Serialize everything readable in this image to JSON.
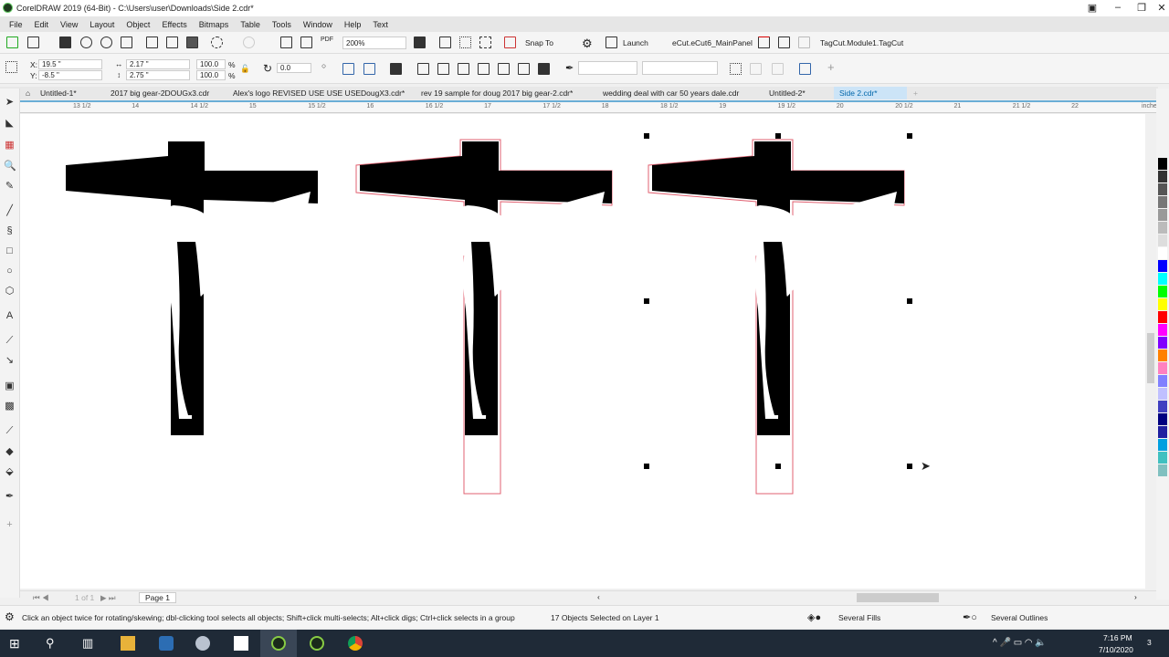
{
  "window": {
    "title": "CorelDRAW 2019 (64-Bit) - C:\\Users\\user\\Downloads\\Side 2.cdr*"
  },
  "menu": [
    "File",
    "Edit",
    "View",
    "Layout",
    "Object",
    "Effects",
    "Bitmaps",
    "Table",
    "Tools",
    "Window",
    "Help",
    "Text"
  ],
  "toolbar": {
    "zoom": "200%",
    "snap_to": "Snap To",
    "launch": "Launch",
    "macro1": "eCut.eCut6_MainPanel",
    "macro2": "TagCut.Module1.TagCut"
  },
  "property_bar": {
    "x": "19.5 \"",
    "y": "-8.5 \"",
    "width": "2.17 \"",
    "height": "2.75 \"",
    "scale_x": "100.0",
    "scale_y": "100.0",
    "pct": "%",
    "rotation": "0.0"
  },
  "tabs": [
    {
      "label": "Untitled-1*"
    },
    {
      "label": "2017 big gear-2DOUGx3.cdr"
    },
    {
      "label": "Alex's logo REVISED USE USE USEDougX3.cdr*"
    },
    {
      "label": "rev 19 sample for doug 2017 big gear-2.cdr*"
    },
    {
      "label": "wedding deal with car 50 years dale.cdr"
    },
    {
      "label": "Untitled-2*"
    },
    {
      "label": "Side 2.cdr*",
      "active": true
    }
  ],
  "ruler": {
    "labels": [
      "13 1/2",
      "14",
      "14 1/2",
      "15",
      "15 1/2",
      "16",
      "16 1/2",
      "17",
      "17 1/2",
      "18",
      "18 1/2",
      "19",
      "19 1/2",
      "20",
      "20 1/2",
      "21",
      "21 1/2",
      "22"
    ],
    "unit": "inches"
  },
  "page_nav": {
    "counter": "1 of 1",
    "page_tab": "Page 1"
  },
  "status": {
    "hint": "Click an object twice for rotating/skewing; dbl-clicking tool selects all objects; Shift+click multi-selects; Alt+click digs; Ctrl+click selects in a group",
    "selection": "17 Objects Selected on Layer 1",
    "fill": "Several Fills",
    "outline": "Several Outlines"
  },
  "taskbar": {
    "time": "7:16 PM",
    "date": "7/10/2020",
    "notifications": "3"
  },
  "colors": {
    "accent": "#0066aa",
    "outline_red": "#e06070",
    "palette": [
      "#000000",
      "#333333",
      "#555555",
      "#777777",
      "#999999",
      "#bbbbbb",
      "#dddddd",
      "#ffffff",
      "#0000ff",
      "#00ffff",
      "#00ff00",
      "#ffff00",
      "#ff0000",
      "#ff00ff",
      "#8000ff",
      "#ff8000",
      "#ff80c0",
      "#8080ff",
      "#c0c0ff",
      "#4040c0",
      "#000080",
      "#2020a0",
      "#00a0e0",
      "#40c0c0",
      "#80c0c0"
    ]
  }
}
